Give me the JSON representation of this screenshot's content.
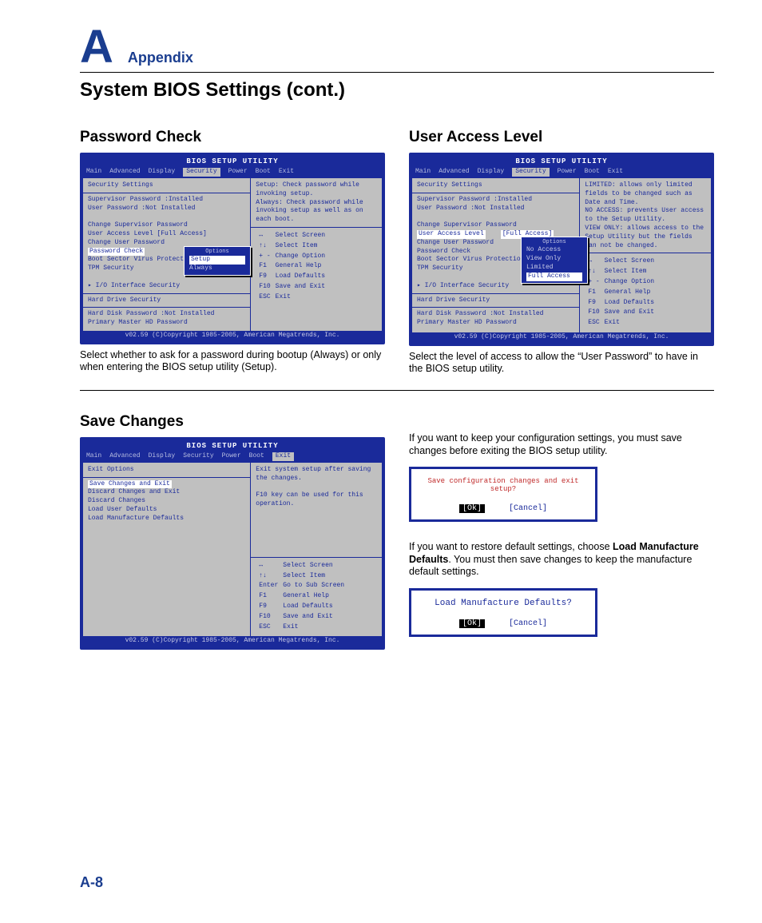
{
  "header": {
    "letter": "A",
    "label": "Appendix",
    "title": "System BIOS Settings (cont.)"
  },
  "pageNumber": "A-8",
  "biosCommon": {
    "utilityTitle": "BIOS SETUP UTILITY",
    "menu": [
      "Main",
      "Advanced",
      "Display",
      "Security",
      "Power",
      "Boot",
      "Exit"
    ],
    "footer": "v02.59 (C)Copyright 1985-2005, American Megatrends, Inc.",
    "keys": [
      [
        "↔",
        "Select Screen"
      ],
      [
        "↑↓",
        "Select Item"
      ],
      [
        "+ -",
        "Change Option"
      ],
      [
        "F1",
        "General Help"
      ],
      [
        "F9",
        "Load Defaults"
      ],
      [
        "F10",
        "Save and Exit"
      ],
      [
        "ESC",
        "Exit"
      ]
    ],
    "keysExit": [
      [
        "↔",
        "Select Screen"
      ],
      [
        "↑↓",
        "Select Item"
      ],
      [
        "Enter",
        "Go to Sub Screen"
      ],
      [
        "F1",
        "General Help"
      ],
      [
        "F9",
        "Load Defaults"
      ],
      [
        "F10",
        "Save and Exit"
      ],
      [
        "ESC",
        "Exit"
      ]
    ]
  },
  "sections": {
    "passwordCheck": {
      "heading": "Password Check",
      "caption": "Select whether to ask for a password during bootup (Always) or only when entering the BIOS setup utility (Setup).",
      "activeMenu": "Security",
      "panelTitle": "Security Settings",
      "rows": [
        "Supervisor Password  :Installed",
        "User Password        :Not Installed"
      ],
      "items": [
        "Change Supervisor Password",
        "User Access Level          [Full Access]",
        "Change User Password"
      ],
      "selected": "Password Check",
      "popupTitle": "Options",
      "popupItems": [
        "Setup",
        "Always"
      ],
      "popupSelected": "Setup",
      "after": [
        "",
        "Boot Sector Virus Protectio",
        "TPM Security"
      ],
      "sub": "▸ I/O Interface Security",
      "group2": "Hard Drive Security",
      "group2rows": [
        "Hard Disk Password   :Not Installed",
        "Primary Master HD Password"
      ],
      "help": "Setup: Check password while invoking setup.\nAlways: Check password while invoking setup as well as on each boot."
    },
    "userAccess": {
      "heading": "User Access Level",
      "caption": "Select the level of access to allow the “User Password” to have in the BIOS setup utility.",
      "activeMenu": "Security",
      "panelTitle": "Security Settings",
      "rows": [
        "Supervisor Password  :Installed",
        "User Password        :Not Installed"
      ],
      "items": [
        "Change Supervisor Password"
      ],
      "selected": "User Access Level",
      "selectedVal": "[Full Access]",
      "after": [
        "Change User Password",
        "Password Check",
        "",
        "Boot Sector Virus Protectio",
        "TPM Security"
      ],
      "popupTitle": "Options",
      "popupItems": [
        "No Access",
        "View Only",
        "Limited",
        "Full Access"
      ],
      "popupSelected": "Full Access",
      "sub": "▸ I/O Interface Security",
      "group2": "Hard Drive Security",
      "group2rows": [
        "Hard Disk Password   :Not Installed",
        "Primary Master HD Password"
      ],
      "help": "LIMITED: allows only limited fields to be changed such as Date and Time.\nNO ACCESS: prevents User access to the Setup Utility.\nVIEW ONLY: allows access to the Setup Utility but the fields can not be changed."
    },
    "saveChanges": {
      "heading": "Save Changes",
      "activeMenu": "Exit",
      "panelTitle": "Exit Options",
      "items": [
        "Save Changes and Exit",
        "Discard Changes and Exit",
        "Discard Changes",
        "",
        "Load User Defaults",
        "Load Manufacture Defaults"
      ],
      "selectedIndex": 0,
      "help": "Exit system setup after saving the changes.\n\nF10 key can be used for this operation.",
      "desc1a": "If you want to keep your configuration settings, you must save changes before exiting the BIOS setup utility.",
      "dialog1": {
        "question": "Save configuration changes and exit setup?",
        "ok": "[Ok]",
        "cancel": "[Cancel]"
      },
      "desc2a": "If you want to restore default settings, choose ",
      "desc2b": "Load Manufacture Defaults",
      "desc2c": ". You must then save changes to keep the manufacture default settings.",
      "dialog2": {
        "question": "Load Manufacture Defaults?",
        "ok": "[Ok]",
        "cancel": "[Cancel]"
      }
    }
  }
}
